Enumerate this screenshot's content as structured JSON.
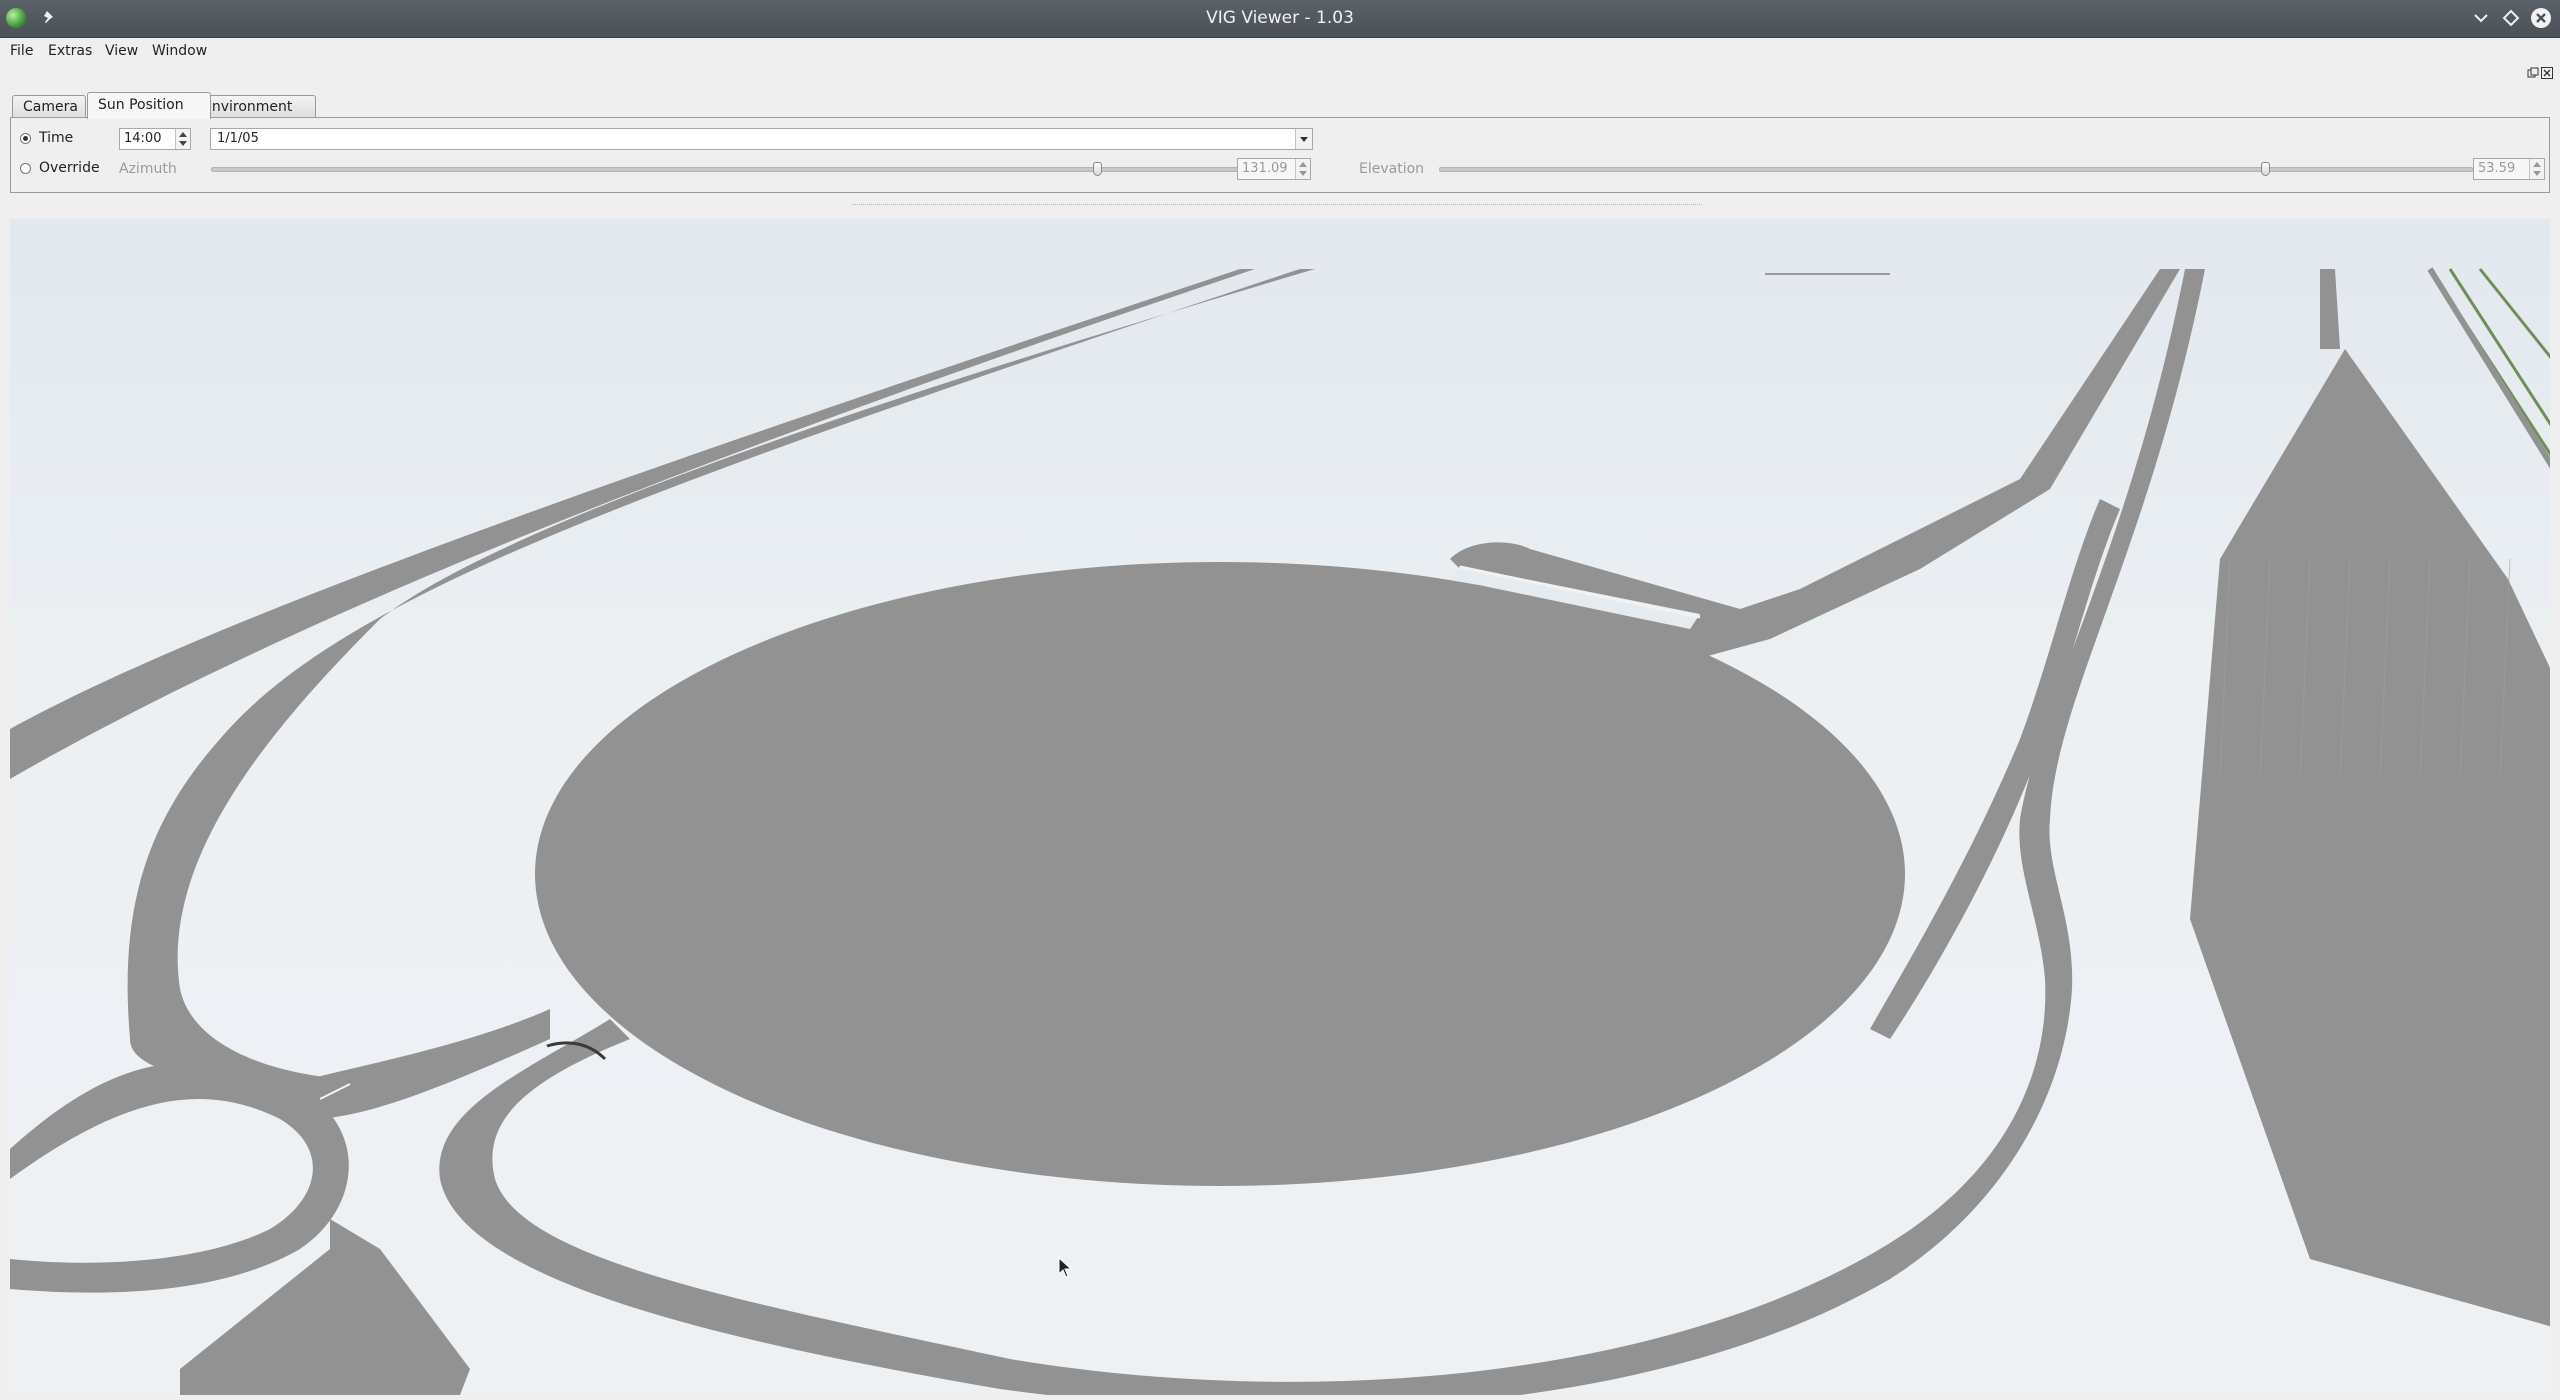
{
  "window": {
    "title": "VIG Viewer - 1.03",
    "icons": [
      "app-globe-icon",
      "pin-icon",
      "chevron-down-icon",
      "diamond-icon",
      "close-icon"
    ]
  },
  "menu": {
    "file": "File",
    "extras": "Extras",
    "view": "View",
    "window": "Window"
  },
  "tabs": {
    "camera": "Camera",
    "sun_position": "Sun Position",
    "environment": "Environment",
    "active": "Sun Position"
  },
  "sun_panel": {
    "time_label": "Time",
    "time_value": "14:00",
    "date_value": "1/1/05",
    "override_label": "Override",
    "mode": "Time",
    "azimuth_label": "Azimuth",
    "azimuth_value": "131.09",
    "azimuth_slider_fraction": 0.86,
    "elevation_label": "Elevation",
    "elevation_value": "53.59",
    "elevation_slider_fraction": 0.8
  },
  "viewport": {
    "scene": "3D road network view (roundabout interchange)",
    "road_color": "#929292",
    "sky_color": "#e6ebf0"
  }
}
